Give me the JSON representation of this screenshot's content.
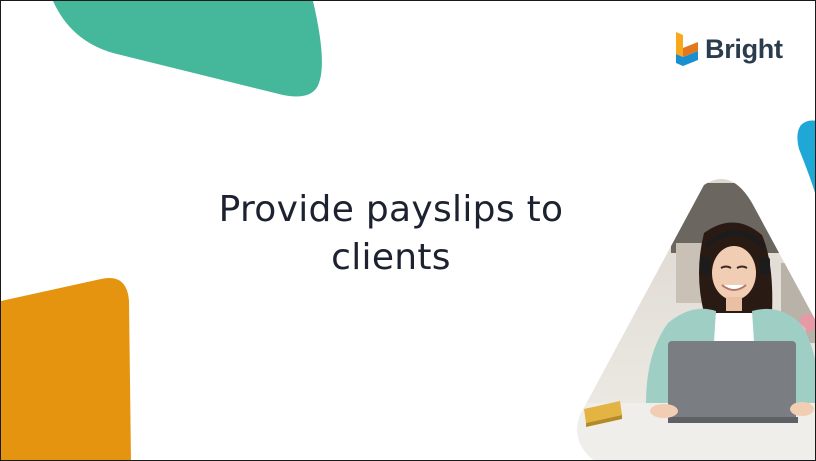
{
  "slide": {
    "title_line1": "Provide payslips to",
    "title_line2": "clients"
  },
  "logo": {
    "text": "Bright",
    "icon": "bright-logo-icon"
  },
  "photo": {
    "icon": "person-with-laptop-photo"
  },
  "colors": {
    "teal": "#45b89c",
    "orange": "#e5940f",
    "blue": "#1fa7d6",
    "text": "#1c2230",
    "logo_text": "#2b3c4e"
  }
}
